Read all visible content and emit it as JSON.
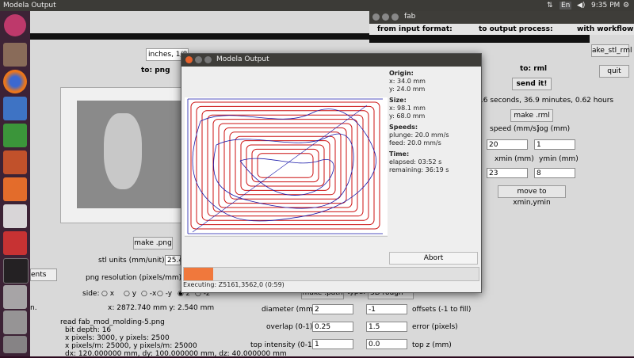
{
  "topbar": {
    "title": "Modela Output",
    "keyboard": "En",
    "time": "9:35 PM"
  },
  "fab": {
    "title": "fab",
    "from_label": "from input format:",
    "to_label": "to output process:",
    "workflow_label": "with workflow:",
    "make_stl_rml": "ake_stl_rml",
    "quit": "quit"
  },
  "bgapp": {
    "units_select": "inches, 1/8",
    "to_png": "to: png",
    "to_rml": "to: rml",
    "send_it": "send it!",
    "time_estimate": "16 seconds, 36.9 minutes, 0.62 hours",
    "make_rml": "make .rml",
    "speed_label": "speed (mm/s)",
    "jog_label": "jog (mm)",
    "speed_value": "20",
    "jog_value": "1",
    "xmin_label": "xmin (mm)",
    "ymin_label": "ymin (mm)",
    "xmin_value": "23",
    "ymin_value": "8",
    "move_btn": "move to xmin,ymin",
    "make_png": "make .png",
    "stl_units_label": "stl units (mm/unit):",
    "stl_units_value": "25.4",
    "png_res_label": "png resolution (pixels/mm):",
    "ents_select": "ents",
    "side_label": "side:",
    "axes": [
      "x",
      "y",
      "z",
      "-x",
      "-y",
      "-z"
    ],
    "n_label": "n.",
    "coords": "x: 2872.740 mm  y: 2.540 mm",
    "read_info": [
      "read fab_mod_molding-5.png",
      "bit depth: 16",
      "x pixels: 3000, y pixels: 2500",
      "x pixels/m: 25000, y pixels/m: 25000",
      "dx: 120.000000 mm, dy: 100.000000 mm, dz: 40.000000 mm"
    ],
    "make_path": "make .path",
    "type_label": "type:",
    "type_value": "3D rough",
    "diameter_label": "diameter (mm)",
    "diameter_value": "2",
    "offsets_value": "-1",
    "offsets_label": "offsets (-1 to fill)",
    "overlap_label": "overlap (0-1)",
    "overlap_value": "0.25",
    "error_value": "1.5",
    "error_label": "error (pixels)",
    "top_intensity_label": "top intensity (0-1)",
    "top_intensity_value": "1",
    "top_z_value": "0.0",
    "top_z_label": "top z (mm)"
  },
  "dialog": {
    "title": "Modela Output",
    "origin_label": "Origin:",
    "origin_x": "x: 34.0 mm",
    "origin_y": "y: 24.0 mm",
    "size_label": "Size:",
    "size_x": "x: 98.1 mm",
    "size_y": "y: 68.0 mm",
    "speeds_label": "Speeds:",
    "plunge": "plunge: 20.0 mm/s",
    "feed": "feed: 20.0 mm/s",
    "time_label": "Time:",
    "elapsed": "elapsed: 03:52 s",
    "remaining": "remaining: 36:19 s",
    "abort": "Abort",
    "progress": 0.1,
    "executing": "Executing: Z5161,3562,0 (0:59)"
  },
  "colors": {
    "accent": "#f0783c",
    "toolpath_red": "#cc1111",
    "toolpath_blue": "#1a1aaa"
  }
}
